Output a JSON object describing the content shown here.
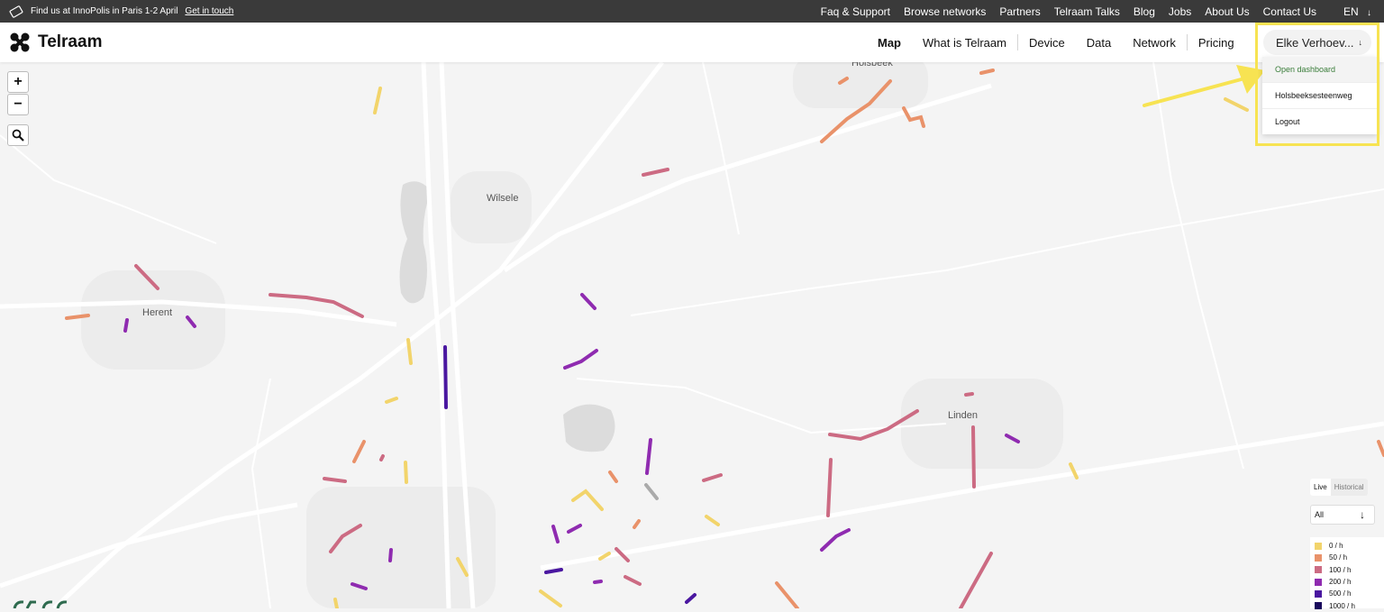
{
  "topbar": {
    "promo_text": "Find us at InnoPolis in Paris 1-2 April",
    "promo_link": "Get in touch",
    "links": [
      "Faq & Support",
      "Browse networks",
      "Partners",
      "Telraam Talks",
      "Blog",
      "Jobs",
      "About Us",
      "Contact Us"
    ],
    "language": "EN"
  },
  "brand": {
    "name": "Telraam"
  },
  "nav": {
    "map": "Map",
    "what": "What is Telraam",
    "device": "Device",
    "data": "Data",
    "network": "Network",
    "pricing": "Pricing"
  },
  "user": {
    "name": "Elke Verhoev...",
    "menu": [
      "Open dashboard",
      "Holsbeeksesteenweg",
      "Logout"
    ]
  },
  "map": {
    "zoom_in": "+",
    "zoom_out": "−",
    "places": {
      "holsbeek": "Holsbeek",
      "wilsele": "Wilsele",
      "herent": "Herent",
      "linden": "Linden"
    }
  },
  "panel": {
    "live": "Live",
    "historical": "Historical",
    "filter_value": "All",
    "legend": [
      {
        "label": "0 / h",
        "color": "#f2d46b"
      },
      {
        "label": "50 / h",
        "color": "#e9926a"
      },
      {
        "label": "100 / h",
        "color": "#cc6b83"
      },
      {
        "label": "200 / h",
        "color": "#8f2bb0"
      },
      {
        "label": "500 / h",
        "color": "#4a17a0"
      },
      {
        "label": "1000 / h",
        "color": "#1a0a5c"
      }
    ]
  },
  "colors": {
    "accent_highlight": "#f7e352",
    "dashboard_link": "#3a7d3a"
  }
}
